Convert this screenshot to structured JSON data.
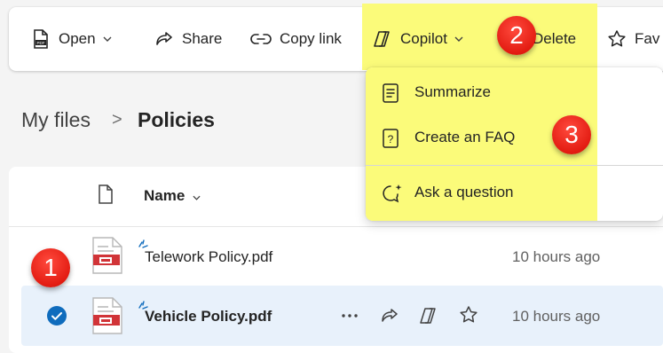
{
  "toolbar": {
    "open_label": "Open",
    "share_label": "Share",
    "copy_link_label": "Copy link",
    "copilot_label": "Copilot",
    "delete_label": "Delete",
    "favorite_label": "Fav"
  },
  "copilot_menu": {
    "items": [
      {
        "label": "Summarize",
        "icon": "summarize-icon"
      },
      {
        "label": "Create an FAQ",
        "icon": "faq-icon"
      },
      {
        "label": "Ask a question",
        "icon": "ask-question-icon"
      }
    ]
  },
  "breadcrumb": {
    "root": "My files",
    "separator": ">",
    "current": "Policies"
  },
  "file_list": {
    "column_name": "Name",
    "rows": [
      {
        "name": "Telework Policy.pdf",
        "modified": "10 hours ago",
        "selected": false
      },
      {
        "name": "Vehicle Policy.pdf",
        "modified": "10 hours ago",
        "selected": true
      }
    ],
    "row_actions": [
      "more-icon",
      "share-icon",
      "copilot-icon",
      "favorite-star-icon"
    ]
  },
  "callouts": [
    "1",
    "2",
    "3"
  ],
  "colors": {
    "highlight": "#fbfb7a",
    "callout_red": "#e31c12",
    "selected_row": "#e8f1fb",
    "check_blue": "#0f6cbd",
    "pdf_red": "#d13438"
  }
}
